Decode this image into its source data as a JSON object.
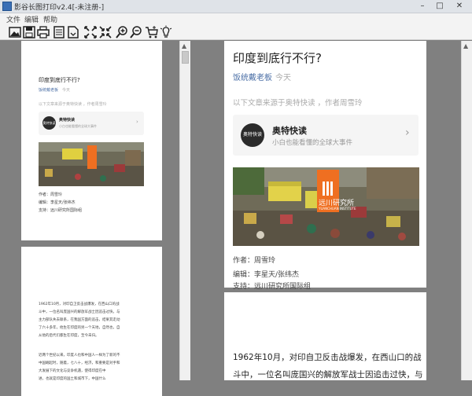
{
  "window": {
    "title": "影谷长图打印v2.4[-未注册-]"
  },
  "menu": {
    "file": "文件",
    "edit": "编辑",
    "help": "帮助"
  },
  "toolbar_icons": [
    "open-image-icon",
    "save-icon",
    "print-icon",
    "settings-icon",
    "export-icon",
    "fit-width-icon",
    "fit-page-icon",
    "zoom-in-icon",
    "zoom-out-icon",
    "cart-icon",
    "tip-icon"
  ],
  "article": {
    "title": "印度到底行不行?",
    "author": "饭统戴老板",
    "date": "今天",
    "intro": "以下文章来源于奥特快读 ，作者周雪玲",
    "card_logo": "奥特快读",
    "card_name": "奥特快读",
    "card_desc": "小白也能看懂的全球大事件",
    "banner_text": "远川研究所",
    "banner_sub": "YUANCHUAN INSTITUTE",
    "meta_author": "作者：周雪玲",
    "meta_editor": "编辑：李星天/张纬杰",
    "meta_support": "支持：远川研究所国际组",
    "body_line1": "1962年10月，对印自卫反击战爆发，在西山口的战",
    "body_line2": "斗中，一位名叫庞国兴的解放军战士因追击过快，与"
  },
  "thumb": {
    "meta_author": "作者：周雪玲",
    "meta_editor": "编辑：李星天/张纬杰",
    "meta_support": "支持：远川研究所国际组",
    "p1": "1962年10月，对印自卫反击战爆发，在西山口的战",
    "p2": "斗中，一位名叫庞国兴的解放军战士因追击过快，与",
    "p3": "主力部队失去联系，在我国方面的追击，结果其走动",
    "p4": "了六十多年，他生在印度的另一个天地，自然也，自",
    "p5": "从他的后代们都生在印度，至今未归。",
    "p6": "近两个世纪以来，印度人也和中国人一样为了新的不",
    "p7": "中国崛起时，随着，七八十，经济，和重要是对手和",
    "p8": "大发展下的文化与竞争机遇，使得印度在中",
    "p9": "进，也就是印度的国土和城市下，中国什么"
  },
  "colors": {
    "accent_orange": "#ef6f21",
    "link_blue": "#4b6fa6",
    "bg_gray": "#808080"
  }
}
